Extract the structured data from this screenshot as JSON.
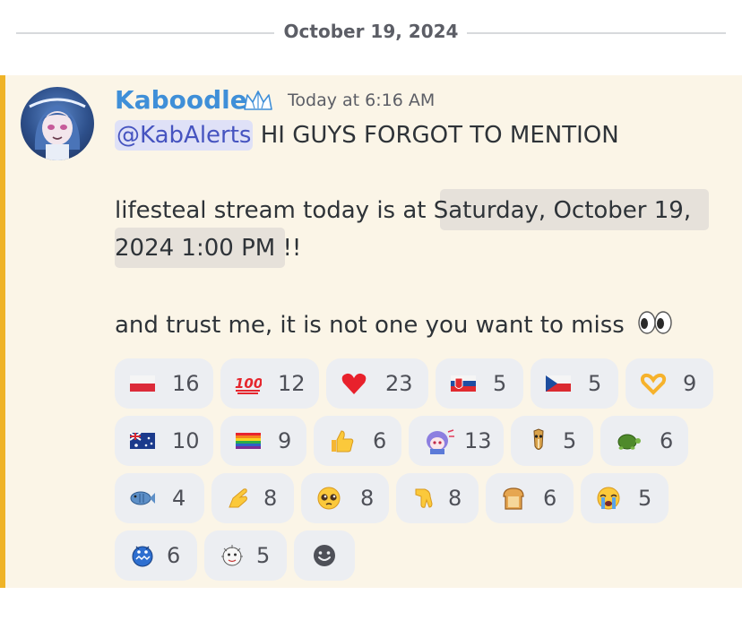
{
  "date_divider": "October 19, 2024",
  "message": {
    "author": "Kaboodle",
    "timestamp": "Today at 6:16 AM",
    "mention": "@KabAlerts",
    "line1_rest": " HI GUYS FORGOT TO MENTION",
    "line2_prefix": "lifesteal stream today is at ",
    "line2_ts": "Saturday, October 19,",
    "line3_ts": "2024 1:00 PM",
    "line3_suffix": " !!",
    "line4": "and trust me, it is not one you want to miss"
  },
  "reactions": [
    {
      "emoji": "poland-flag",
      "count": "16"
    },
    {
      "emoji": "hundred-points",
      "count": "12"
    },
    {
      "emoji": "red-heart",
      "count": "23"
    },
    {
      "emoji": "slovakia-flag",
      "count": "5"
    },
    {
      "emoji": "czech-flag",
      "count": "5"
    },
    {
      "emoji": "heart-hands",
      "count": "9"
    },
    {
      "emoji": "australia-flag",
      "count": "10"
    },
    {
      "emoji": "rainbow-flag",
      "count": "9"
    },
    {
      "emoji": "thumbs-up",
      "count": "6"
    },
    {
      "emoji": "custom-anime-character",
      "count": "13"
    },
    {
      "emoji": "custom-horse-face",
      "count": "5"
    },
    {
      "emoji": "turtle",
      "count": "6"
    },
    {
      "emoji": "fish",
      "count": "4"
    },
    {
      "emoji": "pointing-hand",
      "count": "8"
    },
    {
      "emoji": "pleading-face",
      "count": "8"
    },
    {
      "emoji": "pointing-hand-down",
      "count": "8"
    },
    {
      "emoji": "bread",
      "count": "6"
    },
    {
      "emoji": "loudly-crying-face",
      "count": "5"
    },
    {
      "emoji": "custom-blue-fish",
      "count": "6"
    },
    {
      "emoji": "custom-sketch-face",
      "count": "5"
    }
  ],
  "add_reaction_icon": "smiley-icon",
  "colors": {
    "accent": "#efb327",
    "username": "#3f8fd8",
    "mention_bg": "#dfe1f7",
    "mention_text": "#4654c0",
    "highlight_bg": "#fbf5e7"
  }
}
